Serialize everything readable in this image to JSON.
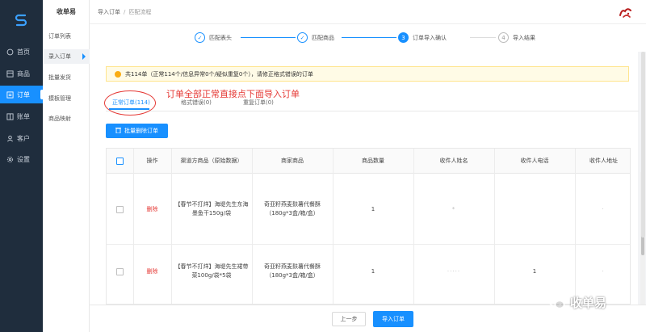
{
  "colors": {
    "sidebar": "#1f2d3d",
    "accent": "#1890ff",
    "danger": "#e53935",
    "warning": "#faad14"
  },
  "sidebar": {
    "logo_icon": "s-logo-icon",
    "items": [
      {
        "label": "首页",
        "icon": "home-icon"
      },
      {
        "label": "商品",
        "icon": "product-icon"
      },
      {
        "label": "订单",
        "icon": "order-icon"
      },
      {
        "label": "账单",
        "icon": "bill-icon"
      },
      {
        "label": "客户",
        "icon": "user-icon"
      },
      {
        "label": "设置",
        "icon": "gear-icon"
      }
    ]
  },
  "submenu": {
    "title": "收单易",
    "items": [
      "订单列表",
      "录入订单",
      "批量发货",
      "模板管理",
      "商品映射"
    ]
  },
  "breadcrumb": {
    "root": "导入订单",
    "sep": "/",
    "current": "匹配流程"
  },
  "steps": [
    {
      "num": "✓",
      "label": "匹配表头"
    },
    {
      "num": "✓",
      "label": "匹配商品"
    },
    {
      "num": "3",
      "label": "订单导入确认"
    },
    {
      "num": "4",
      "label": "导入结果"
    }
  ],
  "notice": "共114单（正常114个/信息异常0个/疑似重复0个），请修正格式错误的订单",
  "tabs": [
    "正常订单(114)",
    "格式错误(0)",
    "重复订单(0)"
  ],
  "annotation": "订单全部正常直接点下面导入订单",
  "bulk_delete_label": "批量删除订单",
  "table": {
    "headers": [
      "操作",
      "渠道方商品（原始数据）",
      "商家商品",
      "商品数量",
      "收件人姓名",
      "收件人电话",
      "收件人地址"
    ],
    "rows": [
      {
        "action": "删除",
        "channel_product": "【春节不打烊】海堤先生东海墨鱼干150g/袋",
        "merchant_product": "奇亚籽燕麦麸薯代餐酥（180g*3盒/箱/盒）",
        "qty": "1",
        "name": "*",
        "phone": "",
        "addr": "·"
      },
      {
        "action": "删除",
        "channel_product": "【春节不打烊】海堤先生裙带菜100g/袋*5袋",
        "merchant_product": "奇亚籽燕麦麸薯代餐酥（180g*3盒/箱/盒）",
        "qty": "1",
        "name": "·····",
        "phone": "1",
        "addr": "·"
      }
    ]
  },
  "footer": {
    "prev_label": "上一步",
    "import_label": "导入订单"
  },
  "watermark": "收单易"
}
